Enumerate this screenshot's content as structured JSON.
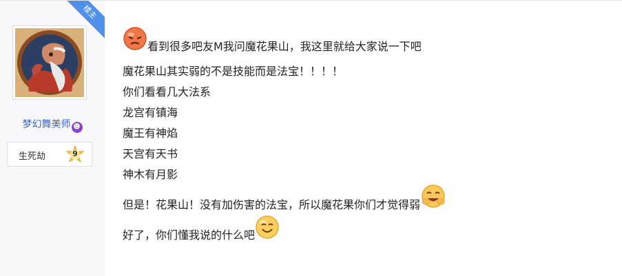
{
  "post": {
    "ribbon_label": "楼主",
    "author": {
      "username": "梦幻舞美师",
      "username_emoji": "devil-emoji",
      "rank_title": "生死劫",
      "level": "9"
    },
    "lines": [
      "看到很多吧友M我问魔花果山，我这里就给大家说一下吧",
      "魔花果山其实弱的不是技能而是法宝！！！！",
      "你们看看几大法系",
      "龙宫有镇海",
      "魔王有神焰",
      "天宫有天书",
      "神木有月影",
      "但是！花果山！没有加伤害的法宝，所以魔花果你们才觉得弱",
      "好了，你们懂我说的什么吧"
    ],
    "emojis": [
      "angry-face-emoji",
      "laughing-emoji",
      "smile-emoji"
    ]
  },
  "colors": {
    "username": "#3a66c4",
    "ribbon": "#4f90ea",
    "sidebar_bg": "#f8f8fb"
  }
}
